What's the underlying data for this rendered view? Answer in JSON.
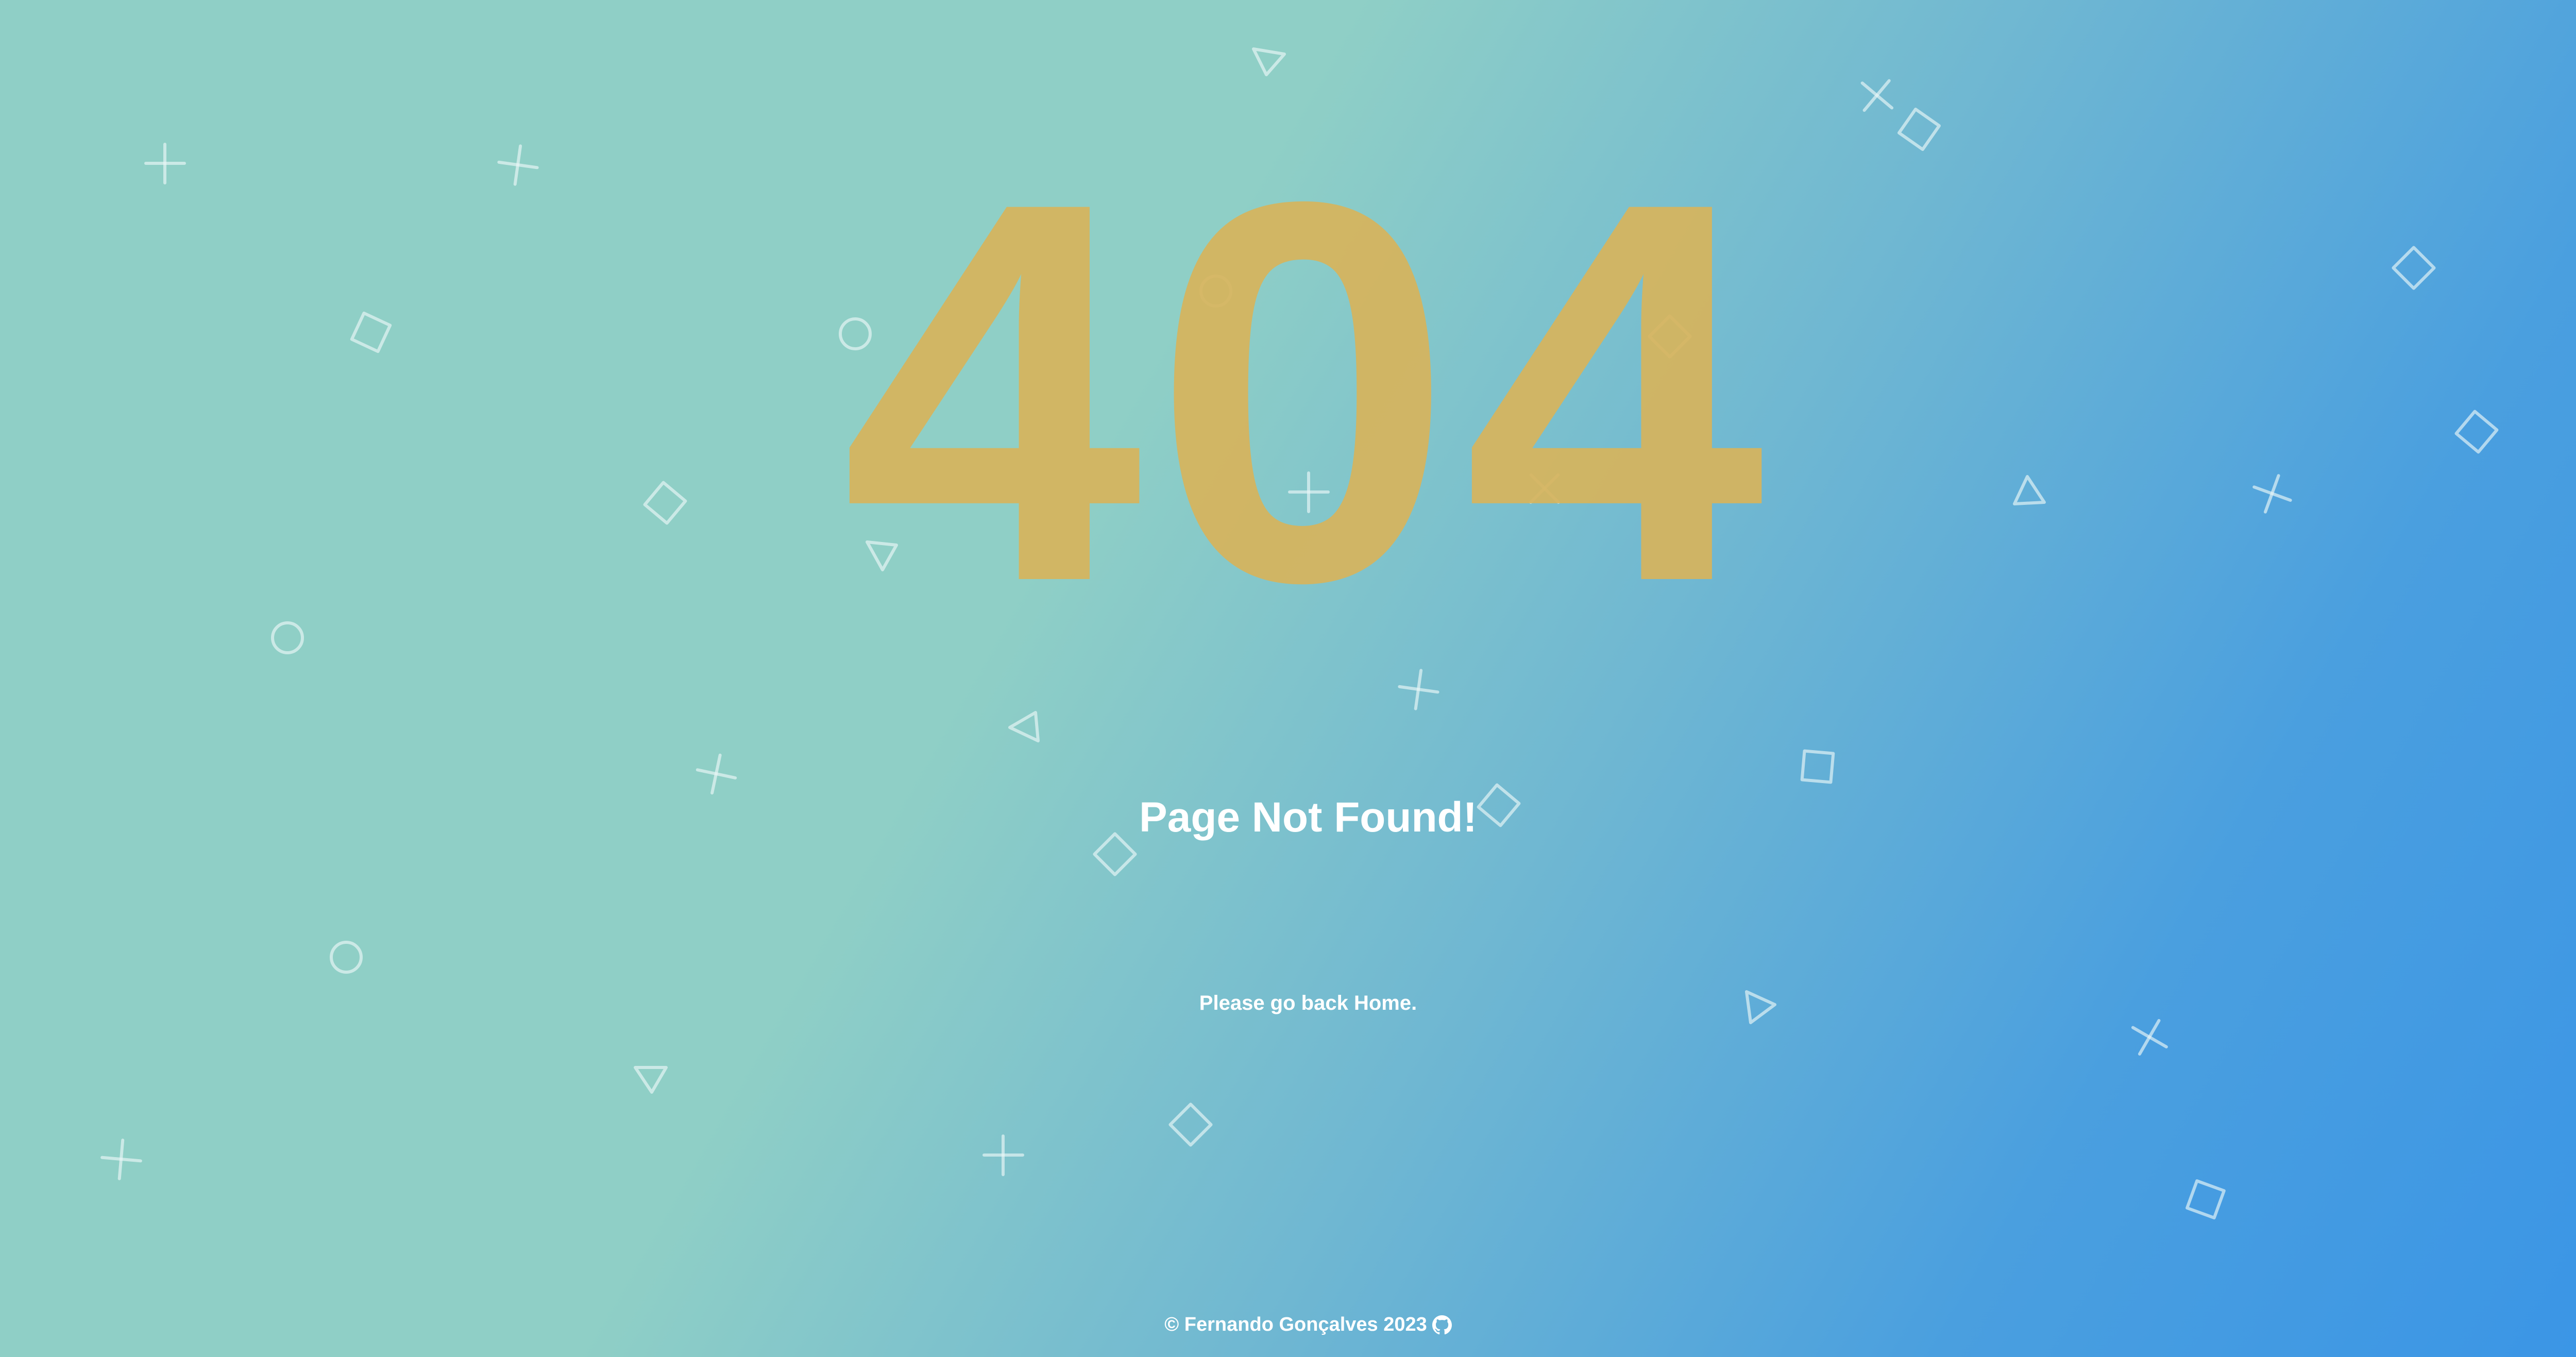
{
  "error": {
    "code": "404",
    "code_color": "#d6b45c"
  },
  "message": {
    "headline": "Page Not Found!",
    "subtext_prefix": "Please go back ",
    "home_link": "Home",
    "subtext_suffix": "."
  },
  "footer": {
    "copyright": "© Fernando Gonçalves 2023",
    "github_icon": "github-icon"
  },
  "background": {
    "gradient_start": "#8fcfc6",
    "gradient_end": "#3a95e6",
    "decorations": [
      "plus-icon",
      "x-icon",
      "circle-icon",
      "square-icon",
      "triangle-icon"
    ]
  }
}
